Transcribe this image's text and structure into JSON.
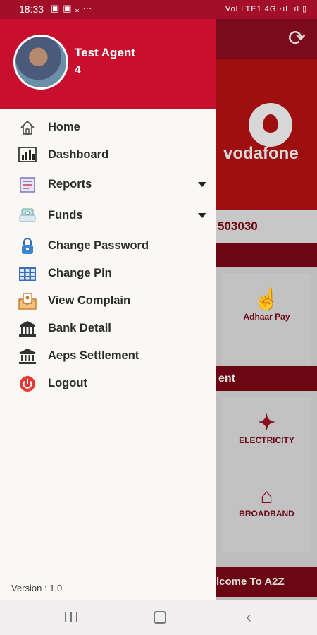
{
  "status_bar": {
    "time": "18:33",
    "notification_icons": [
      "image-icon",
      "image-icon",
      "download-icon",
      "more-icon"
    ],
    "network_text": "Vol LTE1 4G ·ıl ·ıl ▯"
  },
  "drawer": {
    "header": {
      "name": "Test Agent",
      "id": "4",
      "accent": "#c8102e"
    },
    "menu": [
      {
        "label": "Home",
        "icon": "home-icon",
        "expandable": false
      },
      {
        "label": "Dashboard",
        "icon": "bar-chart-icon",
        "expandable": false
      },
      {
        "label": "Reports",
        "icon": "report-icon",
        "expandable": true
      },
      {
        "label": "Funds",
        "icon": "funds-icon",
        "expandable": true
      },
      {
        "label": "Change Password",
        "icon": "lock-icon",
        "expandable": false
      },
      {
        "label": "Change Pin",
        "icon": "keypad-icon",
        "expandable": false
      },
      {
        "label": "View Complain",
        "icon": "complaint-icon",
        "expandable": false
      },
      {
        "label": "Bank Detail",
        "icon": "bank-icon",
        "expandable": false
      },
      {
        "label": "Aeps Settlement",
        "icon": "bank-icon",
        "expandable": false
      },
      {
        "label": "Logout",
        "icon": "power-icon",
        "expandable": false
      }
    ],
    "version": "Version : 1.0"
  },
  "background_app": {
    "brand": "vodafone",
    "number_fragment": "503030",
    "cards": [
      "Adhaar Pay",
      "ELECTRICITY",
      "BROADBAND"
    ],
    "section_fragment": "ent",
    "welcome_fragment": "lcome To A2Z"
  }
}
